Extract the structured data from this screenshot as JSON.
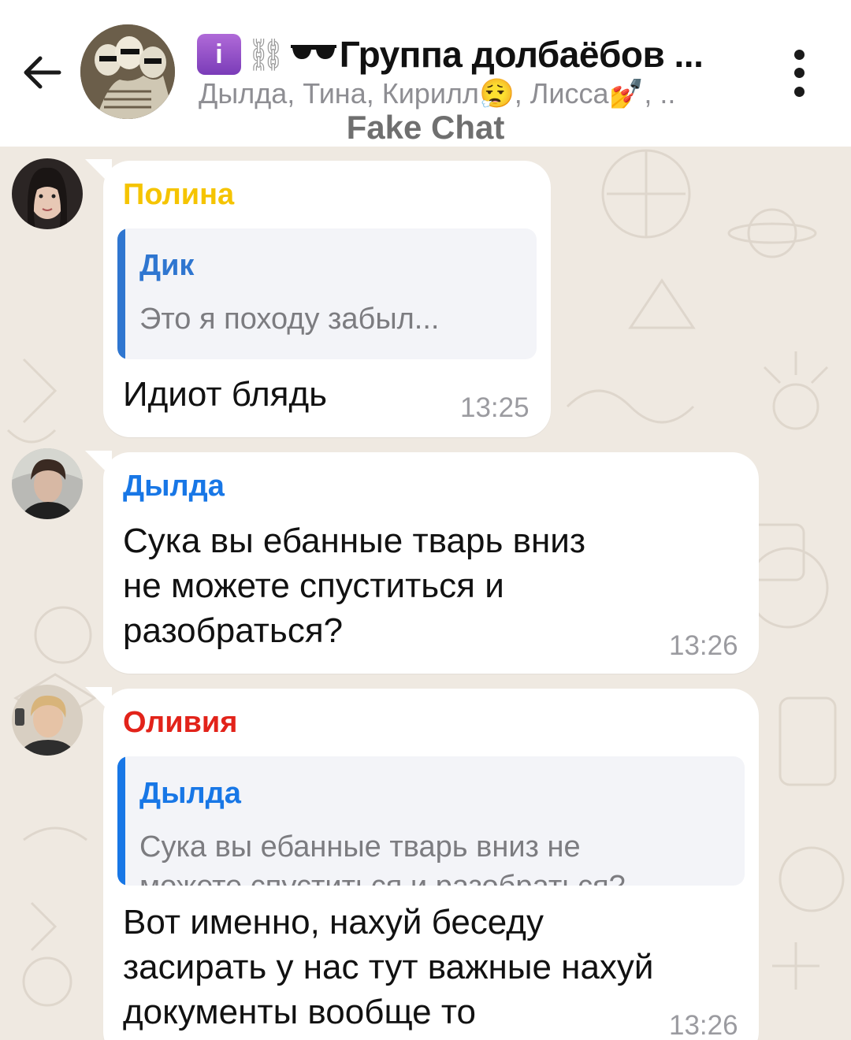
{
  "header": {
    "title": "Группа долбаёбов ...",
    "info_badge": "i",
    "members": "Дылда, Тина, Кирилл😮‍💨, Лисса💅, ..",
    "subtitle": "Fake Chat",
    "icons": {
      "back": "arrow-left-icon",
      "menu": "more-vertical-icon"
    }
  },
  "messages": [
    {
      "sender": "Полина",
      "sender_color": "#f5c400",
      "reply": {
        "name": "Дик",
        "name_color": "#2f76d0",
        "bar_color": "#2f76d0",
        "text": "Это я походу забыл..."
      },
      "text": "Идиот блядь",
      "time": "13:25"
    },
    {
      "sender": "Дылда",
      "sender_color": "#1877e6",
      "lines": [
        "Сука вы ебанные тварь вниз",
        "не можете спуститься и",
        "разобраться?"
      ],
      "time": "13:26"
    },
    {
      "sender": "Оливия",
      "sender_color": "#e2231a",
      "reply": {
        "name": "Дылда",
        "name_color": "#1877e6",
        "bar_color": "#1877e6",
        "text": "Сука вы ебанные тварь вниз не",
        "text2": "можете спуститься и разобраться?"
      },
      "lines": [
        "Вот именно, нахуй беседу",
        "засирать у нас тут важные нахуй",
        "документы вообще то"
      ],
      "time": "13:26"
    }
  ]
}
